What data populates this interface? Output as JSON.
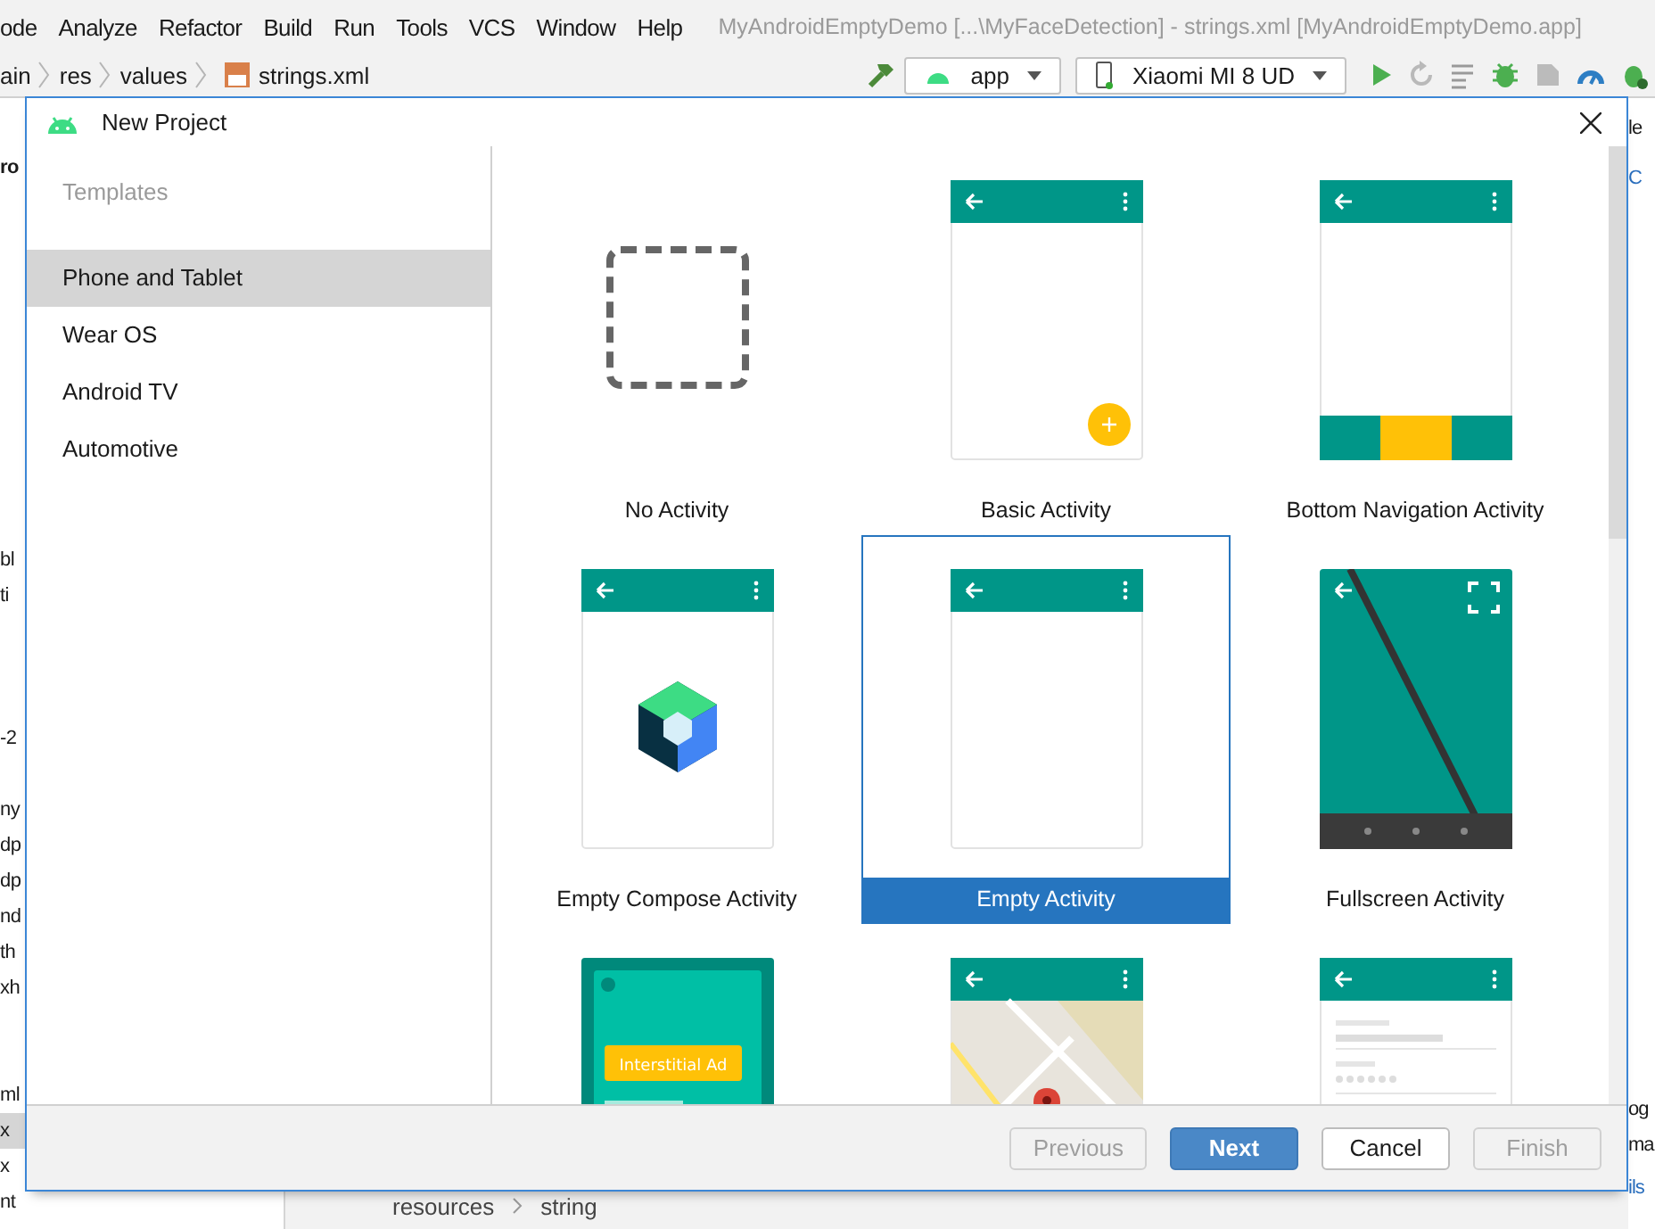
{
  "ide": {
    "menu": [
      "ode",
      "Analyze",
      "Refactor",
      "Build",
      "Run",
      "Tools",
      "VCS",
      "Window",
      "Help"
    ],
    "window_title": "MyAndroidEmptyDemo [...\\MyFaceDetection] - strings.xml [MyAndroidEmptyDemo.app]",
    "breadcrumbs": [
      "ain",
      "res",
      "values",
      "strings.xml"
    ],
    "run_config": "app",
    "device": "Xiaomi MI 8 UD",
    "left_fragments": [
      {
        "text": "ro",
        "kind": "bold"
      },
      {
        "text": "bl",
        "kind": "plain"
      },
      {
        "text": "ti",
        "kind": "plain"
      },
      {
        "text": "-2",
        "kind": "plain"
      },
      {
        "text": "ny",
        "kind": "plain"
      },
      {
        "text": "dp",
        "kind": "plain"
      },
      {
        "text": "dp",
        "kind": "plain"
      },
      {
        "text": "nd",
        "kind": "plain"
      },
      {
        "text": "th",
        "kind": "plain"
      },
      {
        "text": "xh",
        "kind": "plain"
      },
      {
        "text": "ml",
        "kind": "plain"
      },
      {
        "text": "x",
        "kind": "selected"
      },
      {
        "text": "x",
        "kind": "plain"
      },
      {
        "text": "nt",
        "kind": "plain"
      }
    ],
    "right_fragments": [
      {
        "text": "le",
        "kind": "plain"
      },
      {
        "text": "C",
        "kind": "link"
      },
      {
        "text": "og",
        "kind": "plain"
      },
      {
        "text": "ma",
        "kind": "plain"
      },
      {
        "text": "ils",
        "kind": "link"
      }
    ],
    "bottom_breadcrumbs": [
      "resources",
      "string"
    ]
  },
  "dialog": {
    "title": "New Project",
    "sidebar": {
      "heading": "Templates",
      "items": [
        {
          "label": "Phone and Tablet",
          "selected": true
        },
        {
          "label": "Wear OS",
          "selected": false
        },
        {
          "label": "Android TV",
          "selected": false
        },
        {
          "label": "Automotive",
          "selected": false
        }
      ]
    },
    "templates": [
      {
        "kind": "none",
        "label": "No Activity",
        "selected": false
      },
      {
        "kind": "basic",
        "label": "Basic Activity",
        "selected": false
      },
      {
        "kind": "bottom-nav",
        "label": "Bottom Navigation Activity",
        "selected": false
      },
      {
        "kind": "compose",
        "label": "Empty Compose Activity",
        "selected": false
      },
      {
        "kind": "empty",
        "label": "Empty Activity",
        "selected": true
      },
      {
        "kind": "fullscreen",
        "label": "Fullscreen Activity",
        "selected": false
      },
      {
        "kind": "interstitial",
        "ad_text": "Interstitial Ad",
        "selected": false
      },
      {
        "kind": "maps",
        "selected": false
      },
      {
        "kind": "login",
        "selected": false
      }
    ],
    "buttons": [
      {
        "label": "Previous",
        "kind": "normal",
        "disabled": true
      },
      {
        "label": "Next",
        "kind": "primary",
        "disabled": false
      },
      {
        "label": "Cancel",
        "kind": "normal",
        "disabled": false
      },
      {
        "label": "Finish",
        "kind": "normal",
        "disabled": true
      }
    ]
  }
}
